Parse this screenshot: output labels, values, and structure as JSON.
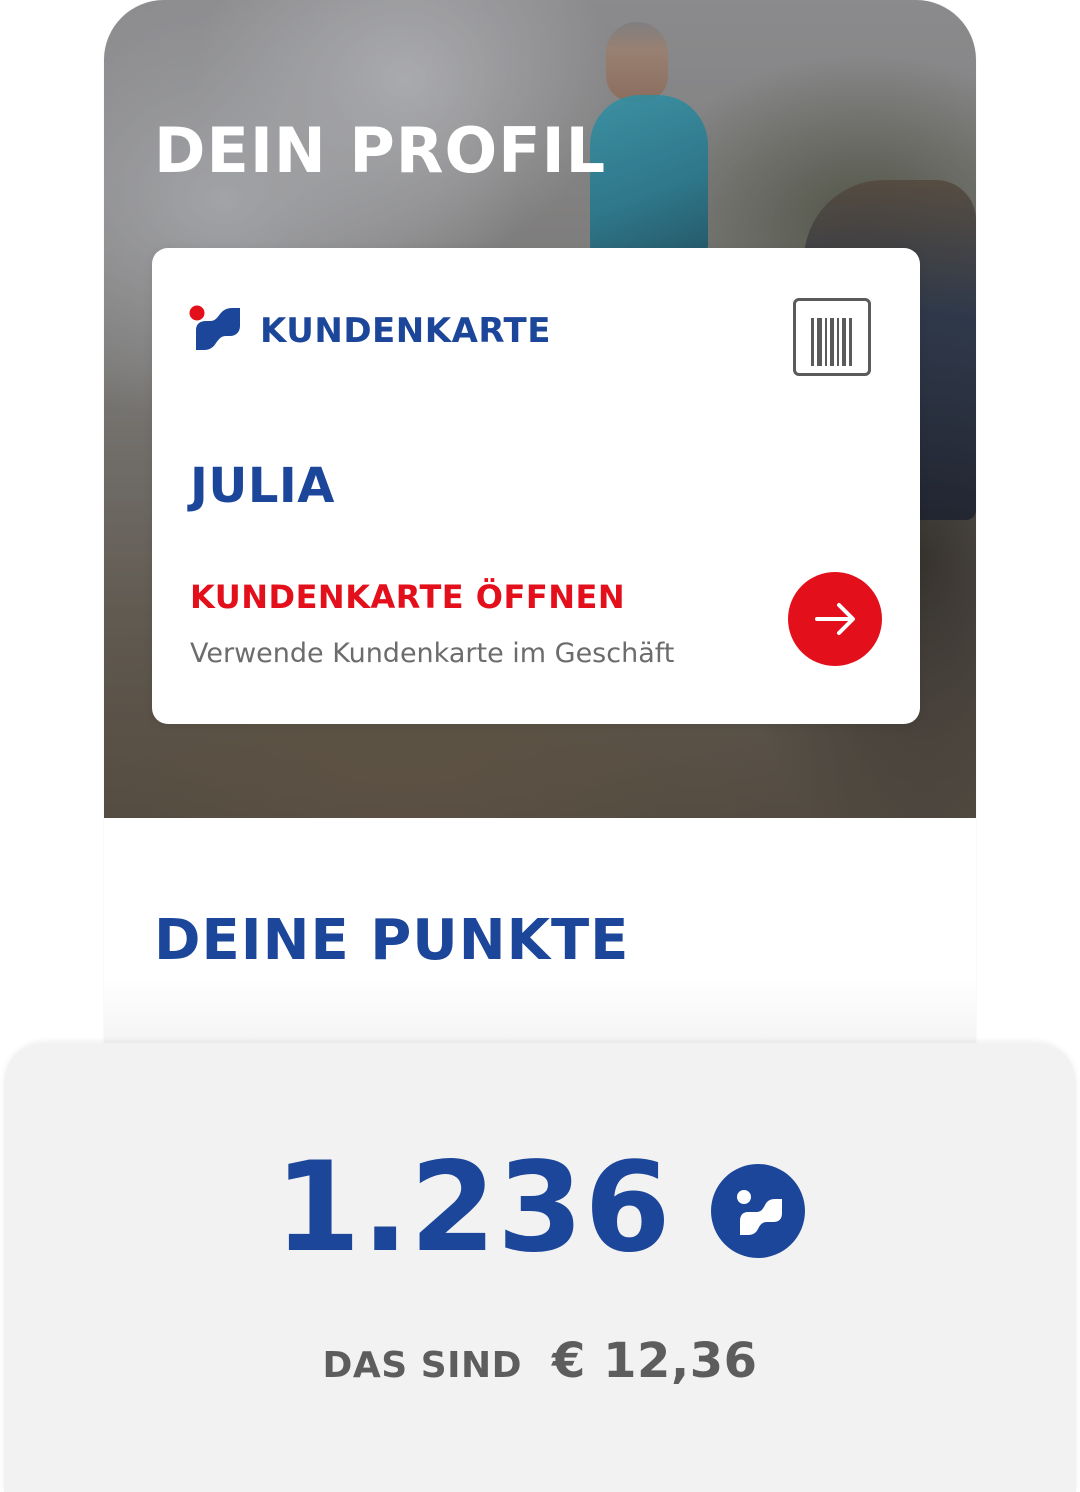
{
  "profile": {
    "title": "DEIN PROFIL"
  },
  "card": {
    "label": "KUNDENKARTE",
    "name": "JULIA",
    "action_title": "KUNDENKARTE ÖFFNEN",
    "action_subtitle": "Verwende Kundenkarte im Geschäft",
    "icons": {
      "brand": "brand-logo-icon",
      "barcode": "barcode-icon",
      "open": "arrow-right-icon"
    }
  },
  "points": {
    "title": "DEINE PUNKTE",
    "value": "1.236",
    "equivalent_label": "DAS SIND",
    "equivalent_amount": "€ 12,36",
    "icon": "points-coin-icon"
  },
  "colors": {
    "brand_blue": "#1c469a",
    "accent_red": "#e3101c",
    "panel_grey": "#f2f2f3",
    "text_grey": "#5d5d5d"
  }
}
